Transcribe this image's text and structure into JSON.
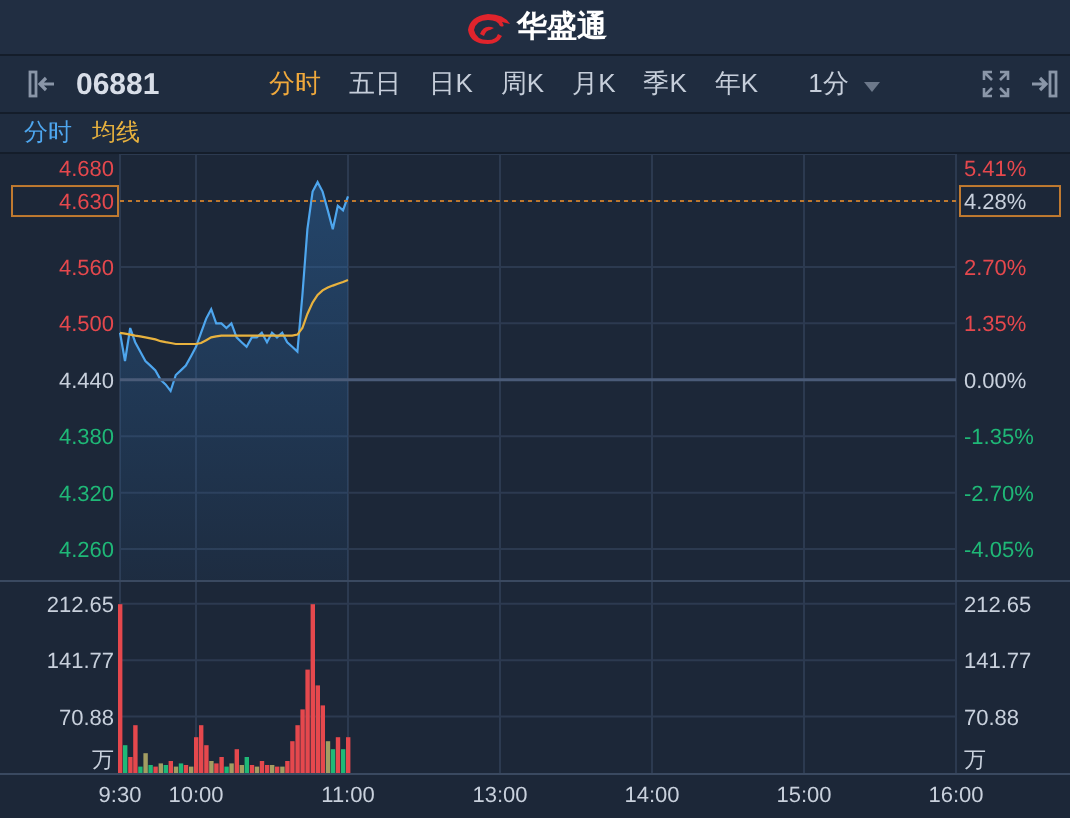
{
  "header": {
    "logo_text": "华盛通"
  },
  "toolbar": {
    "symbol": "06881",
    "tabs": [
      {
        "label": "分时",
        "selected": true
      },
      {
        "label": "五日",
        "selected": false
      },
      {
        "label": "日K",
        "selected": false
      },
      {
        "label": "周K",
        "selected": false
      },
      {
        "label": "月K",
        "selected": false
      },
      {
        "label": "季K",
        "selected": false
      },
      {
        "label": "年K",
        "selected": false
      }
    ],
    "interval": "1分"
  },
  "price_chart": {
    "percent_ticks": [
      {
        "label": "5.41%",
        "color": "#e5484d"
      },
      {
        "label": "2.70%",
        "color": "#e5484d"
      },
      {
        "label": "1.35%",
        "color": "#e5484d"
      },
      {
        "label": "0.00%",
        "color": "#c8d0dc"
      },
      {
        "label": "-1.35%",
        "color": "#1fb877"
      },
      {
        "label": "-2.70%",
        "color": "#1fb877"
      },
      {
        "label": "-4.05%",
        "color": "#1fb877"
      }
    ],
    "current_price": {
      "price": "4.630",
      "change": "4.28%"
    },
    "chart_data": {
      "type": "line",
      "grid": true,
      "ylim": [
        4.225,
        4.68
      ],
      "ref_lines": [
        {
          "axis": "y",
          "value": 4.44,
          "color": "#4a5b78"
        },
        {
          "axis": "y",
          "value": 4.63,
          "color": "#c07a30"
        }
      ],
      "yticks": [
        {
          "value": 4.68,
          "label": "4.680"
        },
        {
          "value": 4.56,
          "label": "4.560"
        },
        {
          "value": 4.5,
          "label": "4.500"
        },
        {
          "value": 4.44,
          "label": "4.440"
        },
        {
          "value": 4.38,
          "label": "4.380"
        },
        {
          "value": 4.32,
          "label": "4.320"
        },
        {
          "value": 4.26,
          "label": "4.260"
        }
      ],
      "series": [
        {
          "name": "分时",
          "color": "#4ea6ee",
          "values": [
            4.49,
            4.46,
            4.495,
            4.48,
            4.47,
            4.46,
            4.455,
            4.45,
            4.44,
            4.435,
            4.428,
            4.445,
            4.45,
            4.455,
            4.465,
            4.475,
            4.49,
            4.505,
            4.515,
            4.5,
            4.5,
            4.495,
            4.5,
            4.485,
            4.48,
            4.475,
            4.485,
            4.485,
            4.49,
            4.48,
            4.49,
            4.485,
            4.49,
            4.48,
            4.475,
            4.47,
            4.53,
            4.6,
            4.64,
            4.65,
            4.64,
            4.62,
            4.6,
            4.625,
            4.62,
            4.635,
            null,
            null,
            null,
            null,
            null,
            null,
            null,
            null,
            null,
            null,
            null,
            null,
            null,
            null,
            null,
            null,
            null,
            null,
            null,
            null,
            null,
            null,
            null,
            null,
            null,
            null,
            null,
            null,
            null,
            null,
            null,
            null,
            null,
            null,
            null,
            null,
            null,
            null,
            null,
            null,
            null,
            null,
            null,
            null,
            null,
            null,
            null,
            null,
            null,
            null,
            null,
            null,
            null,
            null,
            null,
            null,
            null,
            null,
            null,
            null,
            null,
            null,
            null,
            null,
            null,
            null,
            null,
            null,
            null,
            null,
            null,
            null,
            null,
            null,
            null,
            null,
            null,
            null,
            null,
            null,
            null,
            null,
            null,
            null,
            null,
            null,
            null,
            null,
            null,
            null,
            null,
            null,
            null,
            null,
            null,
            null,
            null,
            null,
            null,
            null,
            null,
            null,
            null,
            null,
            null,
            null,
            null,
            null,
            null,
            null,
            null,
            null,
            null,
            null,
            null,
            null,
            null,
            null,
            null,
            null
          ]
        },
        {
          "name": "均线",
          "color": "#e8b23e",
          "values": [
            4.49,
            4.489,
            4.488,
            4.487,
            4.486,
            4.485,
            4.484,
            4.483,
            4.481,
            4.48,
            4.479,
            4.478,
            4.478,
            4.478,
            4.478,
            4.478,
            4.479,
            4.482,
            4.485,
            4.486,
            4.487,
            4.487,
            4.487,
            4.487,
            4.487,
            4.487,
            4.487,
            4.487,
            4.487,
            4.487,
            4.487,
            4.487,
            4.487,
            4.487,
            4.487,
            4.488,
            4.495,
            4.51,
            4.522,
            4.53,
            4.535,
            4.538,
            4.54,
            4.542,
            4.544,
            4.546,
            null,
            null,
            null,
            null,
            null,
            null,
            null,
            null,
            null,
            null,
            null,
            null,
            null,
            null,
            null,
            null,
            null,
            null,
            null,
            null,
            null,
            null,
            null,
            null,
            null,
            null,
            null,
            null,
            null,
            null,
            null,
            null,
            null,
            null,
            null,
            null,
            null,
            null,
            null,
            null,
            null,
            null,
            null,
            null,
            null,
            null,
            null,
            null,
            null,
            null,
            null,
            null,
            null,
            null,
            null,
            null,
            null,
            null,
            null,
            null,
            null,
            null,
            null,
            null,
            null,
            null,
            null,
            null,
            null,
            null,
            null,
            null,
            null,
            null,
            null,
            null,
            null,
            null,
            null,
            null,
            null,
            null,
            null,
            null,
            null,
            null,
            null,
            null,
            null,
            null,
            null,
            null,
            null,
            null,
            null,
            null,
            null,
            null,
            null,
            null,
            null,
            null,
            null,
            null,
            null,
            null,
            null,
            null,
            null,
            null,
            null,
            null,
            null,
            null,
            null,
            null,
            null,
            null,
            null,
            null
          ]
        }
      ]
    }
  },
  "volume_chart": {
    "right_labels": [
      "212.65",
      "141.77",
      "70.88",
      "万"
    ],
    "chart_data": {
      "type": "bar",
      "grid": true,
      "ylim": [
        0,
        240
      ],
      "ylabel": "万",
      "categories": [
        "9:30",
        null,
        null,
        null,
        null,
        null,
        null,
        null,
        null,
        null,
        null,
        null,
        null,
        null,
        null,
        "10:00",
        null,
        null,
        null,
        null,
        null,
        null,
        null,
        null,
        null,
        null,
        null,
        null,
        null,
        null,
        null,
        null,
        null,
        null,
        null,
        null,
        null,
        null,
        null,
        null,
        null,
        null,
        null,
        null,
        null,
        "11:00",
        null,
        null,
        null,
        null,
        null,
        null,
        null,
        null,
        null,
        null,
        null,
        null,
        null,
        null,
        null,
        null,
        null,
        null,
        null,
        null,
        null,
        null,
        null,
        null,
        null,
        null,
        null,
        null,
        null,
        "13:00",
        null,
        null,
        null,
        null,
        null,
        null,
        null,
        null,
        null,
        null,
        null,
        null,
        null,
        null,
        null,
        null,
        null,
        null,
        null,
        null,
        null,
        null,
        null,
        null,
        null,
        null,
        null,
        null,
        null,
        "14:00",
        null,
        null,
        null,
        null,
        null,
        null,
        null,
        null,
        null,
        null,
        null,
        null,
        null,
        null,
        null,
        null,
        null,
        null,
        null,
        null,
        null,
        null,
        null,
        null,
        null,
        null,
        null,
        null,
        null,
        "15:00",
        null,
        null,
        null,
        null,
        null,
        null,
        null,
        null,
        null,
        null,
        null,
        null,
        null,
        null,
        null,
        null,
        null,
        null,
        null,
        null,
        null,
        null,
        null,
        null,
        null,
        null,
        null,
        null,
        null,
        "16:00"
      ],
      "yticks": [
        {
          "value": 212.65,
          "label": "212.65"
        },
        {
          "value": 141.77,
          "label": "141.77"
        },
        {
          "value": 70.88,
          "label": "70.88"
        }
      ],
      "series": [
        {
          "color": "#e5484d",
          "values": [
            212,
            null,
            20,
            60,
            null,
            null,
            null,
            8,
            null,
            null,
            15,
            null,
            null,
            10,
            null,
            45,
            60,
            35,
            null,
            12,
            20,
            null,
            null,
            30,
            null,
            null,
            10,
            null,
            15,
            10,
            null,
            8,
            null,
            15,
            40,
            60,
            80,
            130,
            212,
            110,
            85,
            null,
            null,
            45,
            null,
            45,
            null,
            null,
            null,
            null,
            null,
            null,
            null,
            null,
            null,
            null,
            null,
            null,
            null,
            null,
            null,
            null,
            null,
            null,
            null,
            null,
            null,
            null,
            null,
            null,
            null,
            null,
            null,
            null,
            null,
            null,
            null,
            null,
            null,
            null,
            null,
            null,
            null,
            null,
            null,
            null,
            null,
            null,
            null,
            null,
            null,
            null,
            null,
            null,
            null,
            null,
            null,
            null,
            null,
            null,
            null,
            null,
            null,
            null,
            null,
            null,
            null,
            null,
            null,
            null,
            null,
            null,
            null,
            null,
            null,
            null,
            null,
            null,
            null,
            null,
            null,
            null,
            null,
            null,
            null,
            null,
            null,
            null,
            null,
            null,
            null,
            null,
            null,
            null,
            null,
            null,
            null,
            null,
            null,
            null,
            null,
            null,
            null,
            null,
            null,
            null,
            null,
            null,
            null,
            null,
            null,
            null,
            null,
            null,
            null,
            null,
            null,
            null,
            null,
            null,
            null,
            null,
            null,
            null,
            null,
            null
          ]
        },
        {
          "color": "#1fb877",
          "values": [
            null,
            35,
            null,
            null,
            8,
            null,
            10,
            null,
            null,
            10,
            null,
            null,
            12,
            null,
            null,
            null,
            null,
            null,
            null,
            null,
            null,
            8,
            null,
            null,
            null,
            20,
            null,
            null,
            null,
            null,
            null,
            null,
            null,
            null,
            null,
            null,
            null,
            null,
            null,
            null,
            null,
            null,
            30,
            null,
            30,
            null,
            null,
            null,
            null,
            null,
            null,
            null,
            null,
            null,
            null,
            null,
            null,
            null,
            null,
            null,
            null,
            null,
            null,
            null,
            null,
            null,
            null,
            null,
            null,
            null,
            null,
            null,
            null,
            null,
            null,
            null,
            null,
            null,
            null,
            null,
            null,
            null,
            null,
            null,
            null,
            null,
            null,
            null,
            null,
            null,
            null,
            null,
            null,
            null,
            null,
            null,
            null,
            null,
            null,
            null,
            null,
            null,
            null,
            null,
            null,
            null,
            null,
            null,
            null,
            null,
            null,
            null,
            null,
            null,
            null,
            null,
            null,
            null,
            null,
            null,
            null,
            null,
            null,
            null,
            null,
            null,
            null,
            null,
            null,
            null,
            null,
            null,
            null,
            null,
            null,
            null,
            null,
            null,
            null,
            null,
            null,
            null,
            null,
            null,
            null,
            null,
            null,
            null,
            null,
            null,
            null,
            null,
            null,
            null,
            null,
            null,
            null,
            null,
            null,
            null,
            null,
            null,
            null,
            null,
            null,
            null
          ]
        },
        {
          "color": "#a39d62",
          "values": [
            null,
            null,
            null,
            null,
            null,
            25,
            null,
            null,
            12,
            null,
            null,
            8,
            null,
            null,
            8,
            null,
            null,
            null,
            15,
            null,
            null,
            null,
            12,
            null,
            10,
            null,
            null,
            8,
            null,
            null,
            10,
            null,
            8,
            null,
            null,
            null,
            null,
            null,
            null,
            null,
            null,
            40,
            null,
            null,
            null,
            null,
            null,
            null,
            null,
            null,
            null,
            null,
            null,
            null,
            null,
            null,
            null,
            null,
            null,
            null,
            null,
            null,
            null,
            null,
            null,
            null,
            null,
            null,
            null,
            null,
            null,
            null,
            null,
            null,
            null,
            null,
            null,
            null,
            null,
            null,
            null,
            null,
            null,
            null,
            null,
            null,
            null,
            null,
            null,
            null,
            null,
            null,
            null,
            null,
            null,
            null,
            null,
            null,
            null,
            null,
            null,
            null,
            null,
            null,
            null,
            null,
            null,
            null,
            null,
            null,
            null,
            null,
            null,
            null,
            null,
            null,
            null,
            null,
            null,
            null,
            null,
            null,
            null,
            null,
            null,
            null,
            null,
            null,
            null,
            null,
            null,
            null,
            null,
            null,
            null,
            null,
            null,
            null,
            null,
            null,
            null,
            null,
            null,
            null,
            null,
            null,
            null,
            null,
            null,
            null,
            null,
            null,
            null,
            null,
            null,
            null,
            null,
            null,
            null,
            null,
            null,
            null,
            null,
            null,
            null,
            null
          ]
        }
      ]
    }
  }
}
